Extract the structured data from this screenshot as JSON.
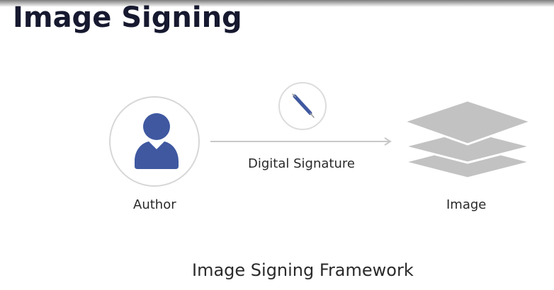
{
  "slide": {
    "title": "Image Signing",
    "caption": "Image Signing Framework"
  },
  "diagram": {
    "author": {
      "label": "Author",
      "icon": "person-icon",
      "icon_color": "#3f58a0"
    },
    "arrow": {
      "label": "Digital Signature",
      "icon": "pen-icon",
      "icon_color": "#3f58a0"
    },
    "image": {
      "label": "Image",
      "icon": "stacked-layers-icon",
      "icon_color": "#bdbdbd"
    }
  },
  "colors": {
    "title": "#16192f",
    "accent": "#3f58a0",
    "outline": "#d7d7d7",
    "layer_gray": "#bdbdbd"
  }
}
